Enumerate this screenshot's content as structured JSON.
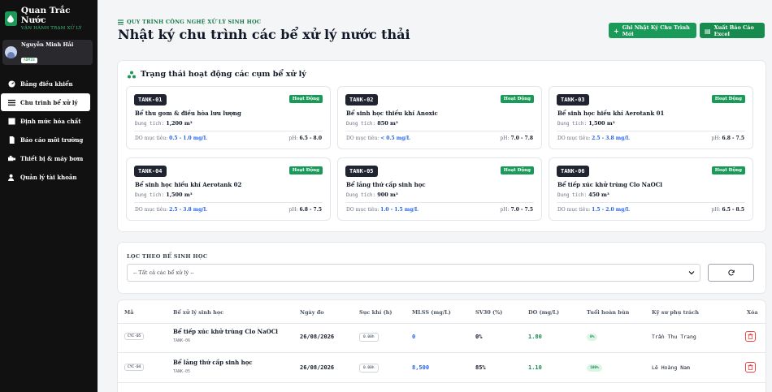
{
  "brand": {
    "title": "Quan Trắc Nước",
    "subtitle": "VẬN HÀNH TRẠM XỬ LÝ"
  },
  "user": {
    "name": "Nguyễn Minh Hải",
    "role": "ADMIN"
  },
  "nav": [
    {
      "label": "Bảng điều khiển",
      "icon": "dashboard-icon",
      "active": false
    },
    {
      "label": "Chu trình bể xử lý",
      "icon": "list-icon",
      "active": true
    },
    {
      "label": "Định mức hóa chất",
      "icon": "flask-icon",
      "active": false
    },
    {
      "label": "Báo cáo môi trường",
      "icon": "report-icon",
      "active": false
    },
    {
      "label": "Thiết bị & máy bơm",
      "icon": "pump-icon",
      "active": false
    },
    {
      "label": "Quản lý tài khoản",
      "icon": "users-icon",
      "active": false
    }
  ],
  "header": {
    "eyebrow": "QUY TRÌNH CÔNG NGHỆ XỬ LÝ SINH HỌC",
    "title": "Nhật ký chu trình các bể xử lý nước thải",
    "new_button": "Ghi Nhật Ký Chu Trình Mới",
    "excel_button": "Xuất Báo Cáo Excel"
  },
  "status": {
    "heading": "Trạng thái hoạt động các cụm bể xử lý",
    "capacity_label": "Dung tích:",
    "target_label": "DO mục tiêu:",
    "ph_label": "pH:",
    "tanks": [
      {
        "code": "TANK-01",
        "status": "Hoạt Động",
        "name": "Bể thu gom & điều hòa lưu lượng",
        "capacity": "1,200 m³",
        "do_target": "0.5 - 1.0 mg/L",
        "ph": "6.5 - 8.0"
      },
      {
        "code": "TANK-02",
        "status": "Hoạt Động",
        "name": "Bể sinh học thiếu khí Anoxic",
        "capacity": "850 m³",
        "do_target": "< 0.5 mg/L",
        "ph": "7.0 - 7.8"
      },
      {
        "code": "TANK-03",
        "status": "Hoạt Động",
        "name": "Bể sinh học hiếu khí Aerotank 01",
        "capacity": "1,500 m³",
        "do_target": "2.5 - 3.8 mg/L",
        "ph": "6.8 - 7.5"
      },
      {
        "code": "TANK-04",
        "status": "Hoạt Động",
        "name": "Bể sinh học hiếu khí Aerotank 02",
        "capacity": "1,500 m³",
        "do_target": "2.5 - 3.8 mg/L",
        "ph": "6.8 - 7.5"
      },
      {
        "code": "TANK-05",
        "status": "Hoạt Động",
        "name": "Bể lắng thứ cấp sinh học",
        "capacity": "900 m³",
        "do_target": "1.0 - 1.5 mg/L",
        "ph": "7.0 - 7.5"
      },
      {
        "code": "TANK-06",
        "status": "Hoạt Động",
        "name": "Bể tiếp xúc khử trùng Clo NaOCl",
        "capacity": "450 m³",
        "do_target": "1.5 - 2.0 mg/L",
        "ph": "6.5 - 8.5"
      }
    ]
  },
  "filter": {
    "label": "LỌC THEO BỂ SINH HỌC",
    "selected": "-- Tất cả các bể xử lý --"
  },
  "table": {
    "columns": [
      "Mã",
      "Bể xử lý sinh học",
      "Ngày đo",
      "Sục khí (h)",
      "MLSS (mg/L)",
      "SV30 (%)",
      "DO (mg/L)",
      "Tuổi hoàn bùn",
      "Kỹ sư phụ trách",
      "Xóa"
    ],
    "rows": [
      {
        "code": "CYC-05",
        "tank_name": "Bể tiếp xúc khử trùng Clo NaOCl",
        "tank_code": "TANK-06",
        "date": "26/08/2026",
        "aeration": "0.00h",
        "mlss": "0",
        "sv30": "0%",
        "do": "1.80",
        "age": "0%",
        "engineer": "Trần Thu Trang"
      },
      {
        "code": "CYC-04",
        "tank_name": "Bể lắng thứ cấp sinh học",
        "tank_code": "TANK-05",
        "date": "26/08/2026",
        "aeration": "0.00h",
        "mlss": "8,500",
        "sv30": "85%",
        "do": "1.10",
        "age": "100%",
        "engineer": "Lê Hoàng Nam"
      }
    ]
  },
  "colors": {
    "accent": "#1a9a58",
    "sidebar": "#111111",
    "link_blue": "#2563eb"
  }
}
